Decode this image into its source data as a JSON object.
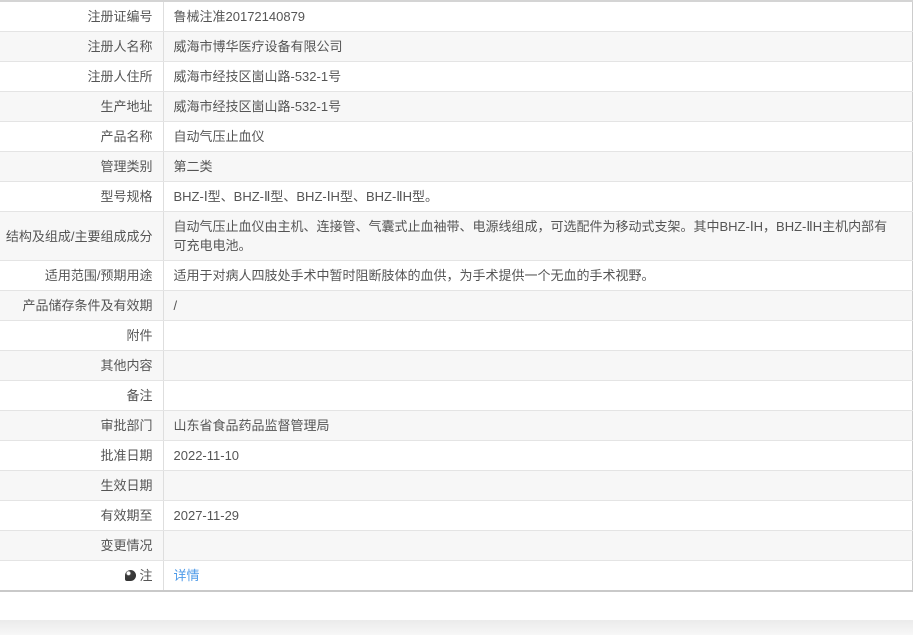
{
  "colors": {
    "link_color": "#4d9ae8",
    "row_alt_bg": "#f7f7f7",
    "text_color": "#555555",
    "line_color": "#e4e4e4"
  },
  "table": {
    "rows": [
      {
        "label": "注册证编号",
        "value": "鲁械注准20172140879"
      },
      {
        "label": "注册人名称",
        "value": "威海市博华医疗设备有限公司"
      },
      {
        "label": "注册人住所",
        "value": "威海市经技区崮山路-532-1号"
      },
      {
        "label": "生产地址",
        "value": "威海市经技区崮山路-532-1号"
      },
      {
        "label": "产品名称",
        "value": "自动气压止血仪"
      },
      {
        "label": "管理类别",
        "value": "第二类"
      },
      {
        "label": "型号规格",
        "value": "BHZ-Ⅰ型、BHZ-Ⅱ型、BHZ-ⅠH型、BHZ-ⅡH型。"
      },
      {
        "label": "结构及组成/主要组成成分",
        "value": "自动气压止血仪由主机、连接管、气囊式止血袖带、电源线组成，可选配件为移动式支架。其中BHZ-ⅠH，BHZ-ⅡH主机内部有可充电电池。"
      },
      {
        "label": "适用范围/预期用途",
        "value": "适用于对病人四肢处手术中暂时阻断肢体的血供，为手术提供一个无血的手术视野。"
      },
      {
        "label": "产品储存条件及有效期",
        "value": "/"
      },
      {
        "label": "附件",
        "value": ""
      },
      {
        "label": "其他内容",
        "value": ""
      },
      {
        "label": "备注",
        "value": ""
      },
      {
        "label": "审批部门",
        "value": "山东省食品药品监督管理局"
      },
      {
        "label": "批准日期",
        "value": "2022-11-10"
      },
      {
        "label": "生效日期",
        "value": ""
      },
      {
        "label": "有效期至",
        "value": "2027-11-29"
      },
      {
        "label": "变更情况",
        "value": ""
      }
    ],
    "note_row": {
      "label": "注",
      "icon": "balloon-icon",
      "link_label": "详情"
    }
  }
}
